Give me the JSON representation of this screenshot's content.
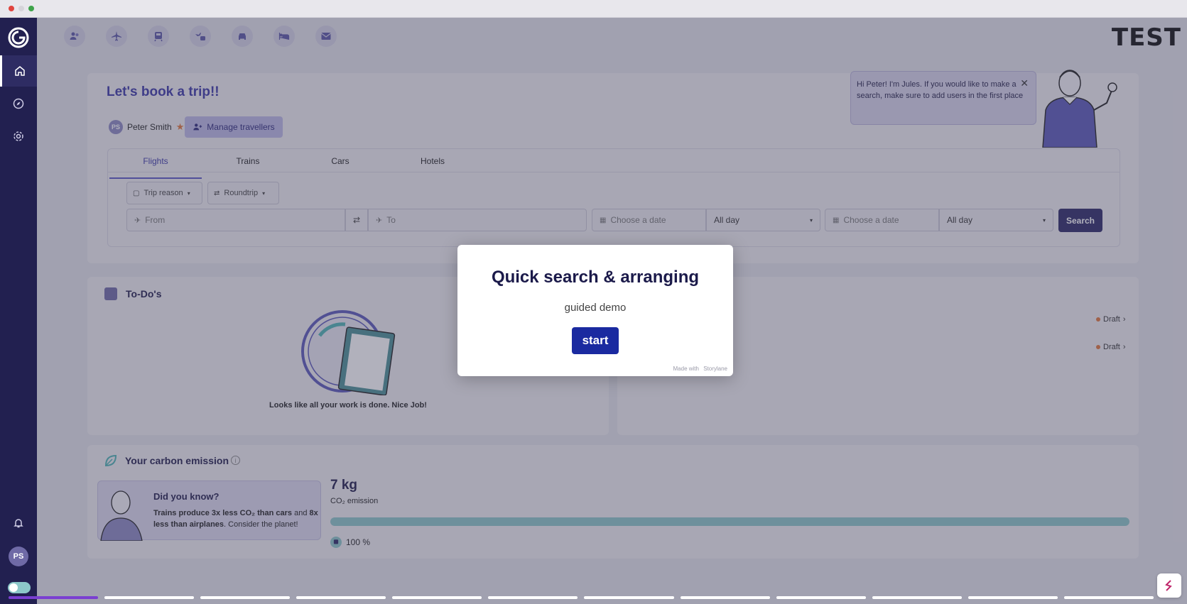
{
  "brand": "TEST",
  "trip": {
    "title": "Let's book a trip!!",
    "traveller_name": "Peter Smith",
    "traveller_initials": "PS",
    "manage_label": "Manage travellers",
    "tabs": [
      "Flights",
      "Trains",
      "Cars",
      "Hotels"
    ],
    "trip_reason": "Trip reason",
    "roundtrip": "Roundtrip",
    "from_placeholder": "From",
    "to_placeholder": "To",
    "date1_placeholder": "Choose a date",
    "time1": "All day",
    "date2_placeholder": "Choose a date",
    "time2": "All day",
    "search_label": "Search"
  },
  "assistant": {
    "message": "Hi Peter! I'm Jules. If you would like to make a search, make sure to add users in the first place"
  },
  "todo": {
    "title": "To-Do's",
    "empty_text": "Looks like all your work is done. Nice Job!"
  },
  "trips_list": {
    "drafts": [
      "Draft",
      "Draft"
    ]
  },
  "carbon": {
    "title": "Your carbon emission",
    "dyk_title": "Did you know?",
    "dyk_bold1": "Trains produce 3x less CO₂ than cars",
    "dyk_mid": " and ",
    "dyk_bold2": "8x less than airplanes",
    "dyk_end": ". Consider the planet!",
    "amount": "7 kg",
    "emission_label": "CO₂ emission",
    "percent": "100 %",
    "progress_fraction": 1.0
  },
  "sidebar": {
    "initials": "PS"
  },
  "modal": {
    "title": "Quick search & arranging",
    "subtitle": "guided demo",
    "start": "start",
    "madewith": "Made with  Storylane"
  },
  "steps": {
    "count": 12,
    "active_index": 0
  },
  "colors": {
    "accent": "#3b38a6",
    "sidebar": "#222050",
    "modal_button": "#1a2aa0",
    "progress": "#8cc7c9",
    "step_active": "#7a3fd1"
  }
}
